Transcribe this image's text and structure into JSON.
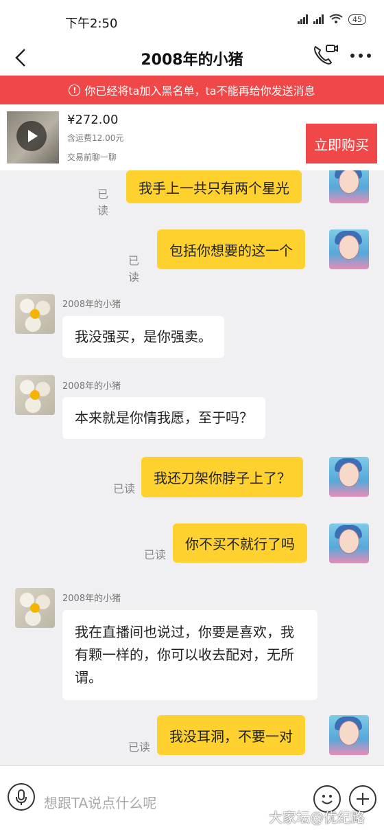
{
  "status": {
    "time": "下午2:50",
    "battery": "45"
  },
  "nav": {
    "title": "2008年的小猪"
  },
  "banner": {
    "text": "你已经将ta加入黑名单，ta不能再给你发送消息"
  },
  "product": {
    "price": "¥272.00",
    "shipping": "含运费12.00元",
    "chat_note": "交易前聊一聊",
    "buy_label": "立即购买"
  },
  "messages": [
    {
      "side": "out",
      "text": "我手上一共只有两个星光",
      "status": "已读"
    },
    {
      "side": "out",
      "text": "包括你想要的这一个",
      "status": "已读"
    },
    {
      "side": "in",
      "sender": "2008年的小猪",
      "text": "我没强买，是你强卖。"
    },
    {
      "side": "in",
      "sender": "2008年的小猪",
      "text": "本来就是你情我愿，至于吗？"
    },
    {
      "side": "out",
      "text": "我还刀架你脖子上了？",
      "status": "已读"
    },
    {
      "side": "out",
      "text": "你不买不就行了吗",
      "status": "已读"
    },
    {
      "side": "in",
      "sender": "2008年的小猪",
      "text": "我在直播间也说过，你要是喜欢，我有颗一样的，你可以收去配对，无所谓。"
    },
    {
      "side": "out",
      "text": "我没耳洞，不要一对",
      "status": "已读"
    }
  ],
  "composer": {
    "placeholder": "想跟TA说点什么呢"
  },
  "watermark": "大家坛@优纪路",
  "colors": {
    "accent_red": "#f04848",
    "my_bubble": "#fed12f",
    "their_bubble": "#ffffff"
  }
}
